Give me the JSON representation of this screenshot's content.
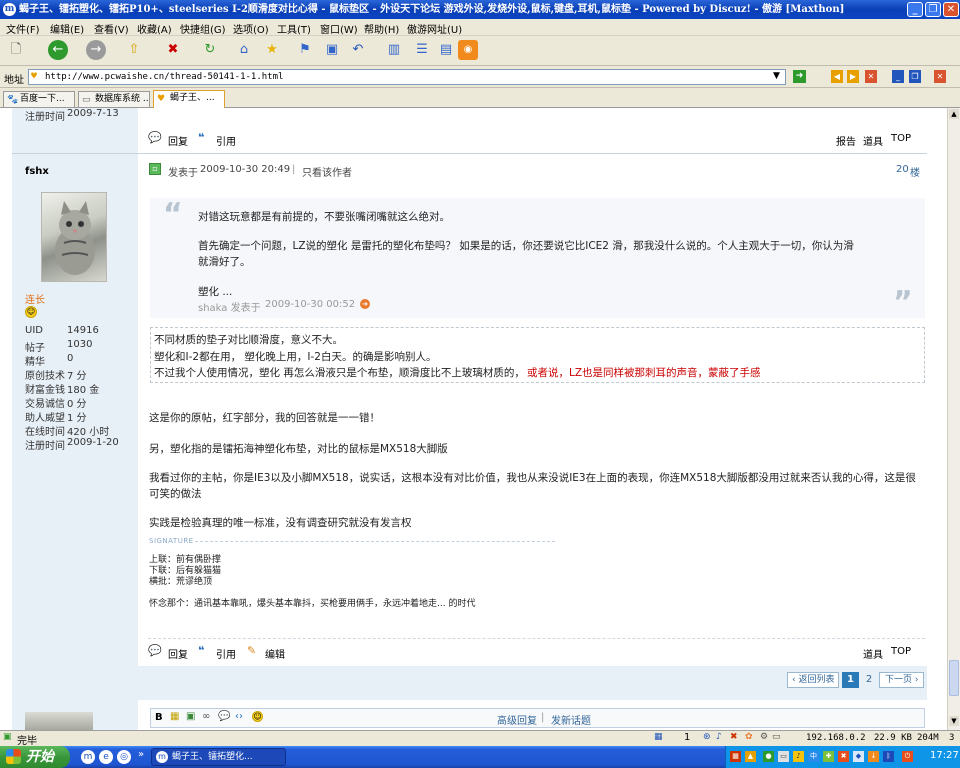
{
  "window": {
    "title": "蝎子王、镭拓塑化、镭拓P10+、steelseries I-2顺滑度对比心得 - 鼠标垫区 - 外设天下论坛 游戏外设,发烧外设,鼠标,键盘,耳机,鼠标垫 - Powered by Discuz! - 傲游 [Maxthon]"
  },
  "menubar": {
    "items": [
      "文件(F)",
      "编辑(E)",
      "查看(V)",
      "收藏(A)",
      "快捷组(G)",
      "选项(O)",
      "工具(T)",
      "窗口(W)",
      "帮助(H)",
      "傲游网址(U)"
    ]
  },
  "address": {
    "label": "地址",
    "url": "http://www.pcwaishe.cn/thread-50141-1-1.html"
  },
  "tabs": [
    "百度一下...",
    "数据库系统 ...",
    "蝎子王、..."
  ],
  "prev_post": {
    "reg_label": "注册时间",
    "reg_value": "2009-7-13",
    "reply": "回复",
    "quote": "引用",
    "report": "报告",
    "tools": "道具",
    "top": "TOP"
  },
  "post": {
    "author": "fshx",
    "rank": "连长",
    "stats": [
      {
        "label": "UID",
        "value": "14916"
      },
      {
        "label": "帖子",
        "value": "1030"
      },
      {
        "label": "精华",
        "value": "0"
      },
      {
        "label": "原创技术",
        "value": "7 分"
      },
      {
        "label": "财富金钱",
        "value": "180 金"
      },
      {
        "label": "交易诚信",
        "value": "0 分"
      },
      {
        "label": "助人威望",
        "value": "1 分"
      },
      {
        "label": "在线时间",
        "value": "420 小时"
      },
      {
        "label": "注册时间",
        "value": "2009-1-20"
      }
    ],
    "posted_prefix": "发表于",
    "posted_time": "2009-10-30 20:49",
    "only_author": "只看该作者",
    "floor_num": "20",
    "floor_suffix": "楼",
    "quote_lines": [
      "对错这玩意都是有前提的，不要张嘴闭嘴就这么绝对。",
      "首先确定一个问题，LZ说的塑化 是雷托的塑化布垫吗？ 如果是的话，你还要说它比ICE2 滑，那我没什么说的。个人主观大于一切，你认为滑",
      "就滑好了。",
      "塑化 ..."
    ],
    "quote_author": "shaka 发表于",
    "quote_time": "2009-10-30 00:52",
    "cite_lines": [
      "不同材质的垫子对比顺滑度，意义不大。",
      "塑化和I-2都在用， 塑化晚上用，I-2白天。的确是影响别人。",
      "不过我个人使用情况，塑化 再怎么滑液只是个布垫，顺滑度比不上玻璃材质的，"
    ],
    "cite_red": "或者说，LZ也是同样被那刺耳的声音，蒙蔽了手感",
    "body": [
      "这是你的原帖，红字部分，我的回答就是一一错！",
      "另，塑化指的是镭拓海神塑化布垫，对比的鼠标是MX518大脚版",
      "我看过你的主帖，你是IE3以及小脚MX518，说实话，这根本没有对比价值，我也从来没说IE3在上面的表现，你连MX518大脚版都没用过就来否认我的心得，这是很",
      "可笑的做法",
      "实践是检验真理的唯一标准，没有调查研究就没有发言权"
    ],
    "signature_label": "SIGNATURE",
    "signature": [
      "上联：前有偶卧撑",
      "下联：后有躲猫猫",
      "横批：荒谬绝顶"
    ],
    "signature_tail": "怀念那个：通讯基本靠吼，爆头基本靠抖，买枪要用俩手，永远冲着地走...  的时代",
    "reply": "回复",
    "quote": "引用",
    "edit": "编辑",
    "tools": "道具",
    "top": "TOP"
  },
  "pagination": {
    "back": "‹ 返回列表",
    "current": "1",
    "next_page": "2",
    "next": "下一页 ›"
  },
  "editor": {
    "advanced": "高级回复",
    "new_topic": "发新话题"
  },
  "statusbar": {
    "text": "完毕",
    "count": "1",
    "ip": "192.168.0.2",
    "size": "22.9 KB",
    "mem": "204M",
    "num": "3"
  },
  "taskbar": {
    "start": "开始",
    "task": "蝎子王、镭拓塑化...",
    "clock": "17:27"
  },
  "colors": {
    "title_blue": "#0a3fb5",
    "sidebar": "#e8f0f7",
    "link_blue": "#336699",
    "red_text": "#cc0000",
    "rank_orange": "#e37016"
  }
}
